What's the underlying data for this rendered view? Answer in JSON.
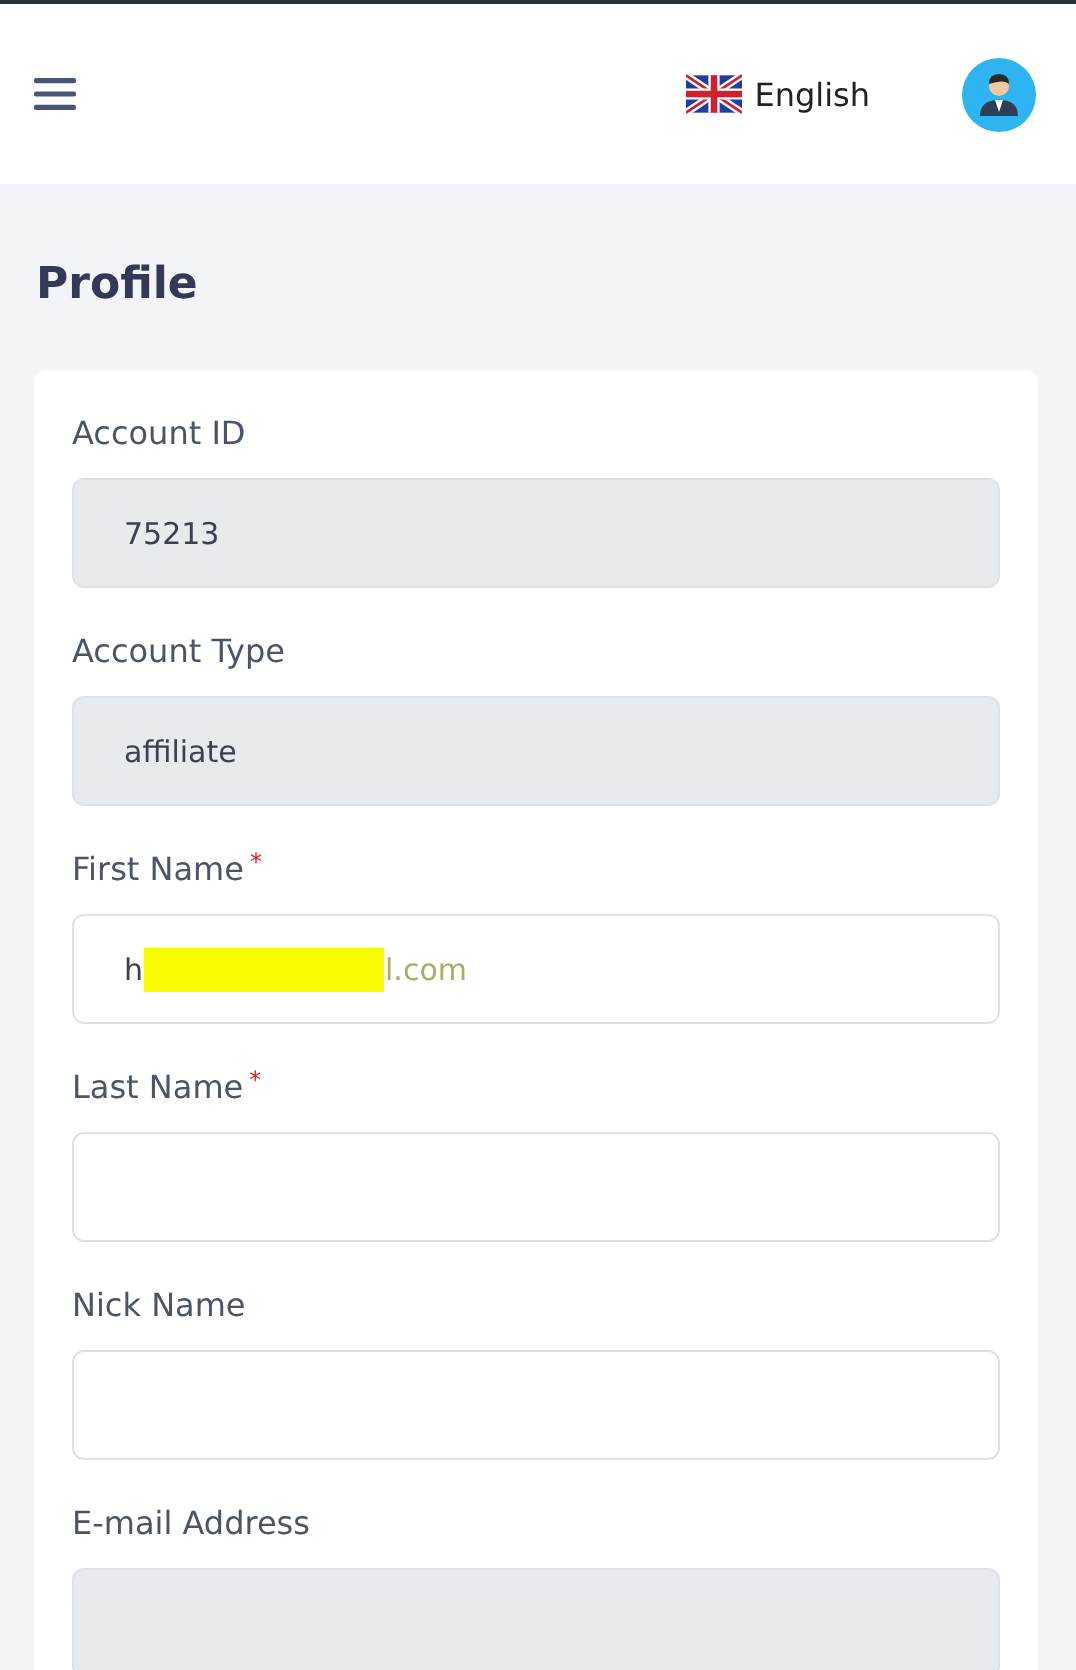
{
  "header": {
    "language": "English"
  },
  "page_title": "Profile",
  "fields": [
    {
      "label": "Account ID",
      "disabled": true,
      "value": "75213"
    },
    {
      "label": "Account Type",
      "disabled": true,
      "value": "affiliate"
    },
    {
      "label": "First Name",
      "required_mark": "*",
      "disabled": false,
      "value": "h",
      "redacted": true,
      "value_end": "l.com"
    },
    {
      "label": "Last Name",
      "required_mark": "*",
      "disabled": false
    },
    {
      "label": "Nick Name",
      "disabled": false
    },
    {
      "label": "E-mail Address",
      "disabled": true
    }
  ]
}
